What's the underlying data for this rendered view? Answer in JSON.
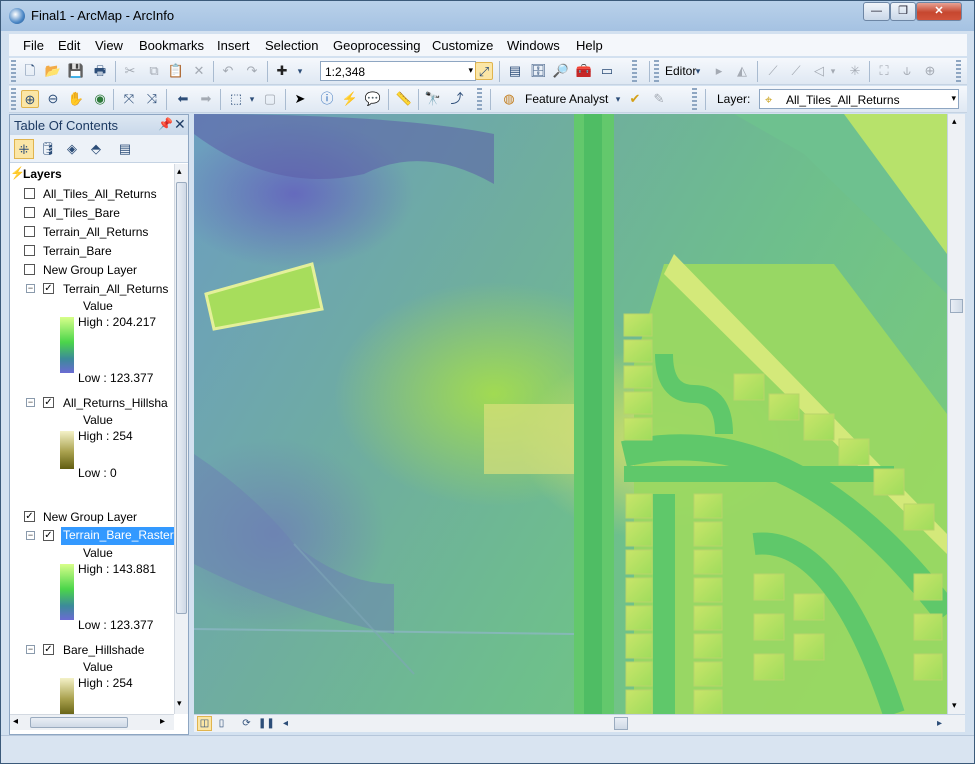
{
  "window": {
    "title": "Final1 - ArcMap - ArcInfo",
    "controls": {
      "minimize": "—",
      "maximize": "❐",
      "close": "✕"
    }
  },
  "menu": [
    "File",
    "Edit",
    "View",
    "Bookmarks",
    "Insert",
    "Selection",
    "Geoprocessing",
    "Customize",
    "Windows",
    "Help"
  ],
  "toolbar": {
    "scale": "1:2,348",
    "editor_label": "Editor",
    "feature_analyst_label": "Feature Analyst",
    "layer_label": "Layer:",
    "layer_value": "All_Tiles_All_Returns"
  },
  "toc": {
    "title": "Table Of Contents",
    "root_label": "Layers",
    "top_layers": [
      "All_Tiles_All_Returns",
      "All_Tiles_Bare",
      "Terrain_All_Returns",
      "Terrain_Bare",
      "New Group Layer"
    ],
    "group1": {
      "raster": {
        "name": "Terrain_All_Returns",
        "value_label": "Value",
        "high": "High : 204.217",
        "low": "Low : 123.377"
      },
      "hillshade": {
        "name": "All_Returns_Hillsha",
        "value_label": "Value",
        "high": "High : 254",
        "low": "Low : 0"
      }
    },
    "group2": {
      "name": "New Group Layer",
      "raster": {
        "name": "Terrain_Bare_Raster",
        "value_label": "Value",
        "high": "High : 143.881",
        "low": "Low : 123.377"
      },
      "hillshade": {
        "name": "Bare_Hillshade",
        "value_label": "Value",
        "high": "High : 254"
      }
    }
  },
  "icons": {
    "arrow_left": "◂",
    "arrow_right": "▸",
    "arrow_up": "▴",
    "arrow_down": "▾"
  }
}
